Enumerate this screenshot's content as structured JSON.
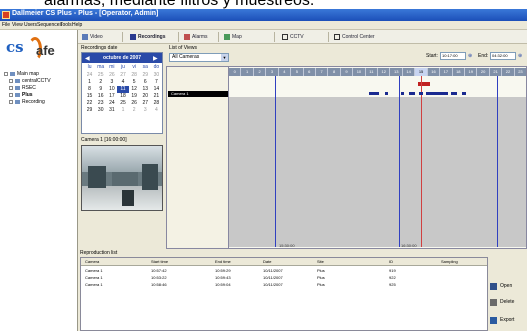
{
  "caption": "alarmas, mediante filtros y muestreos.",
  "window": {
    "title": "Dallmeier CS Plus - Plus - [Operator, Admin]"
  },
  "menu": [
    "File",
    "View",
    "Users",
    "Sequences",
    "Tools",
    "Help"
  ],
  "tabs": [
    {
      "label": "Video",
      "icon": "video-icon"
    },
    {
      "label": "Recordings",
      "icon": "recordings-icon"
    },
    {
      "label": "Alarms",
      "icon": "alarm-icon"
    },
    {
      "label": "Map",
      "icon": "map-icon"
    },
    {
      "label": "CCTV",
      "icon": "cctv-icon"
    },
    {
      "label": "Control Center",
      "icon": "control-icon"
    }
  ],
  "logo": {
    "part1": "cs",
    "part2": "afe"
  },
  "tree": [
    {
      "label": "Main map",
      "level": 0
    },
    {
      "label": "centralCCTV",
      "level": 1
    },
    {
      "label": "RSEC",
      "level": 1
    },
    {
      "label": "Plus",
      "level": 1
    },
    {
      "label": "Recording",
      "level": 1
    }
  ],
  "recordings": {
    "date_label": "Recordings date",
    "month_title": "octubre de 2007",
    "weekdays": [
      "lu",
      "ma",
      "mi",
      "ju",
      "vi",
      "sa",
      "do"
    ],
    "weeks": [
      [
        "24",
        "25",
        "26",
        "27",
        "28",
        "29",
        "30"
      ],
      [
        "1",
        "2",
        "3",
        "4",
        "5",
        "6",
        "7"
      ],
      [
        "8",
        "9",
        "10",
        "11",
        "12",
        "13",
        "14"
      ],
      [
        "15",
        "16",
        "17",
        "18",
        "19",
        "20",
        "21"
      ],
      [
        "22",
        "23",
        "24",
        "25",
        "26",
        "27",
        "28"
      ],
      [
        "29",
        "30",
        "31",
        "1",
        "2",
        "3",
        "4"
      ]
    ],
    "selected_day": "11",
    "camera_title": "Camera 1 [16:00:00]"
  },
  "filters": {
    "list_label": "List of Views",
    "list_value": "All Cameras",
    "start_label": "Start:",
    "start_value": "10:17:00",
    "end_label": "End:",
    "end_value": "04:32:00"
  },
  "timeline": {
    "hours": [
      "0",
      "1",
      "2",
      "3",
      "4",
      "5",
      "6",
      "7",
      "8",
      "9",
      "10",
      "11",
      "12",
      "13",
      "14",
      "15",
      "16",
      "17",
      "18",
      "19",
      "20",
      "21",
      "22",
      "23"
    ],
    "camera_row": "Camera 1",
    "tick_labels": [
      "15:30:00",
      "16:30:00"
    ],
    "highlight_hour": "15"
  },
  "reproduction": {
    "label": "Reproduction list",
    "columns": [
      "Camera",
      "Start time",
      "End time",
      "Date",
      "Site",
      "ID",
      "Sampling"
    ],
    "rows": [
      [
        "Camera 1",
        "10:57:42",
        "10:59:29",
        "10/11/2007",
        "Plus",
        "919",
        ""
      ],
      [
        "Camera 1",
        "10:53:22",
        "10:59:43",
        "10/11/2007",
        "Plus",
        "922",
        ""
      ],
      [
        "Camera 1",
        "10:58:46",
        "10:59:04",
        "10/11/2007",
        "Plus",
        "925",
        ""
      ]
    ]
  },
  "actions": {
    "open": "Open",
    "delete": "Delete",
    "export": "Export"
  },
  "colors": {
    "titlebar": "#1c4fb8",
    "accent": "#2a4aa8",
    "segment": "#1a2a90"
  }
}
